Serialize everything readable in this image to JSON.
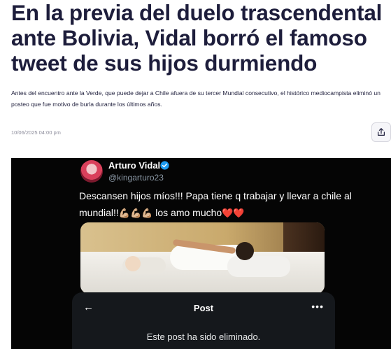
{
  "article": {
    "headline": "En la previa del duelo trascendental ante Bolivia, Vidal borró el famoso tweet de sus hijos durmiendo",
    "lede": "Antes del encuentro ante la Verde, que puede dejar a Chile afuera de su tercer Mundial consecutivo, el histórico mediocampista eliminó un posteo que fue motivo de burla durante los últimos años.",
    "date": "10/06/2025 04:00 pm",
    "share_icon": "share-icon"
  },
  "tweet": {
    "display_name": "Arturo Vidal",
    "handle": "@kingarturo23",
    "text_part1": "Descansen hijos míos!!! Papa tiene q trabajar y llevar a chile al mundial!!",
    "emojis_flex": "💪🏼💪🏼💪🏼",
    "text_part2": " los amo mucho",
    "emojis_hearts": "❤️❤️",
    "verified_icon": "verified-badge-icon"
  },
  "post_screen": {
    "back_icon": "←",
    "title": "Post",
    "more_icon": "•••",
    "deleted_message": "Este post ha sido eliminado."
  },
  "colors": {
    "headline": "#1d1d3b",
    "media_background": "#050505",
    "verified_blue": "#1d9bf0"
  }
}
